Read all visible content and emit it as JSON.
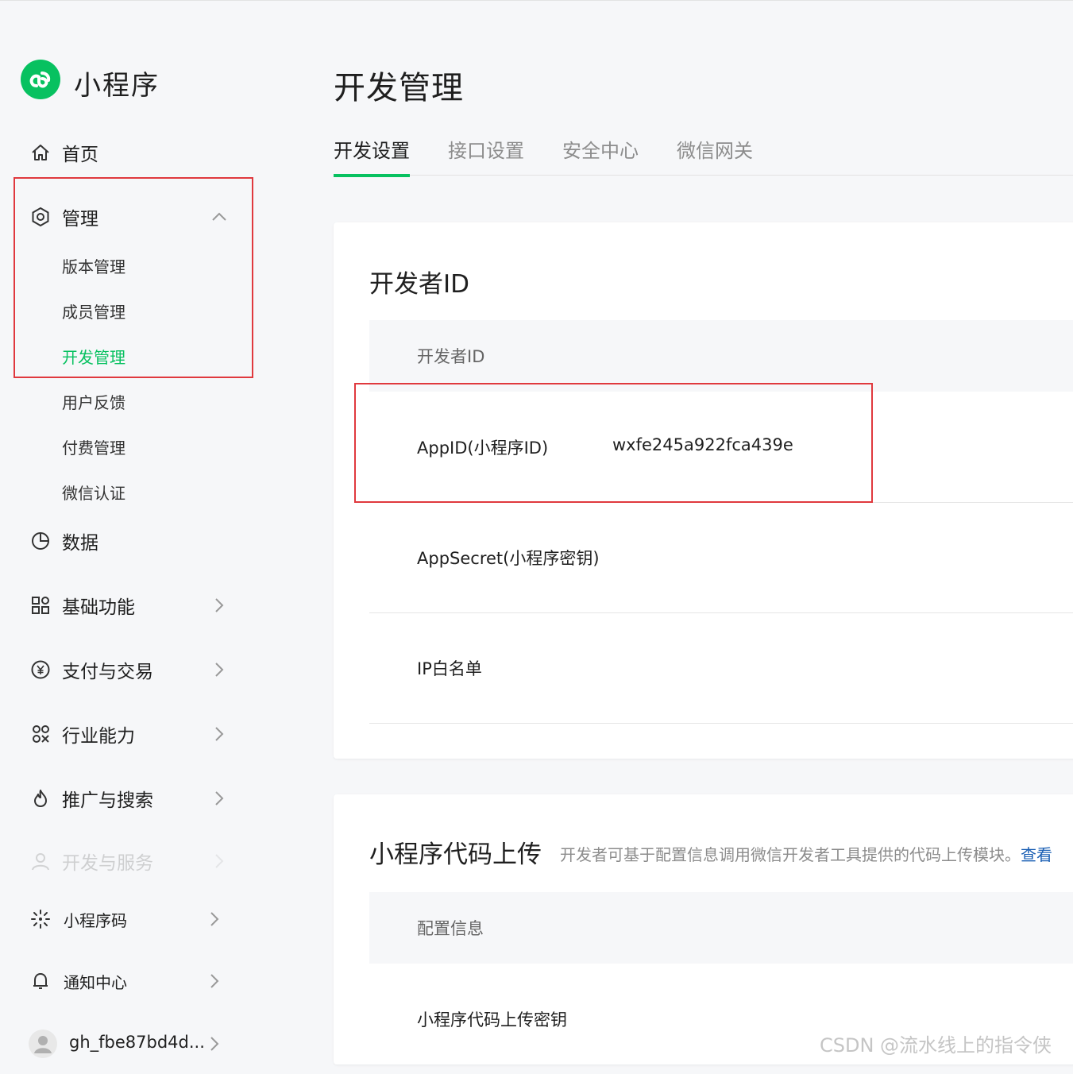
{
  "app": {
    "brand": "小程序"
  },
  "sidebar": {
    "home": "首页",
    "manage": "管理",
    "manage_items": [
      "版本管理",
      "成员管理",
      "开发管理",
      "用户反馈",
      "付费管理",
      "微信认证"
    ],
    "data": "数据",
    "basic": "基础功能",
    "pay": "支付与交易",
    "industry": "行业能力",
    "promo": "推广与搜索",
    "dev_service": "开发与服务",
    "qrcode": "小程序码",
    "notice": "通知中心",
    "account": "gh_fbe87bd4d..."
  },
  "main": {
    "title": "开发管理",
    "tabs": [
      "开发设置",
      "接口设置",
      "安全中心",
      "微信网关"
    ],
    "dev_id_card": {
      "title": "开发者ID",
      "header": "开发者ID",
      "rows": [
        {
          "key": "AppID(小程序ID)",
          "value": "wxfe245a922fca439e"
        },
        {
          "key": "AppSecret(小程序密钥)",
          "value": ""
        },
        {
          "key": "IP白名单",
          "value": ""
        }
      ]
    },
    "upload_card": {
      "title": "小程序代码上传",
      "desc": "开发者可基于配置信息调用微信开发者工具提供的代码上传模块。",
      "link": "查看",
      "header": "配置信息",
      "row1": "小程序代码上传密钥"
    }
  },
  "watermark": "CSDN @流水线上的指令侠",
  "colors": {
    "accent": "#07c160",
    "highlight_box": "#e0393e"
  }
}
